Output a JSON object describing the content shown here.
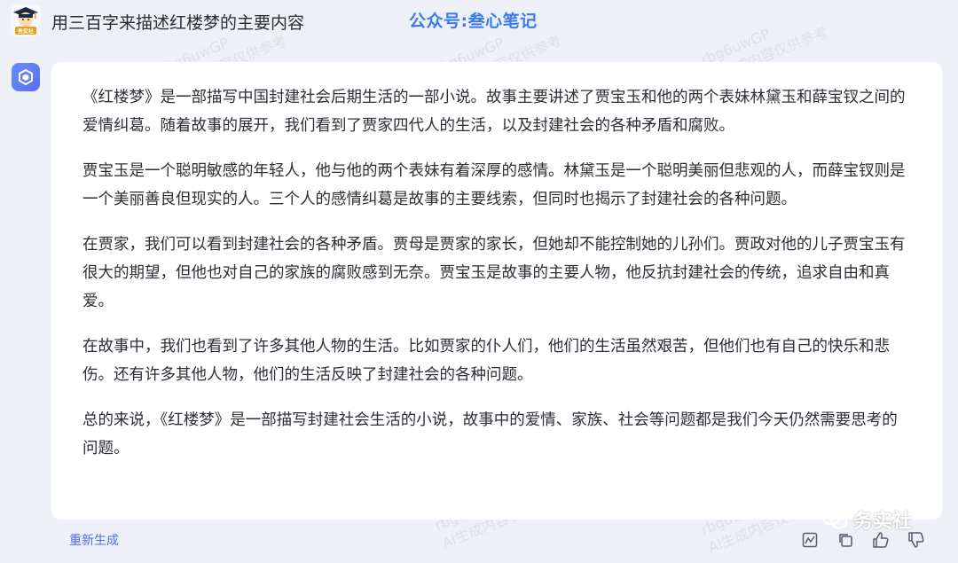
{
  "user": {
    "avatar_caption": "务实社",
    "question": "用三百字来描述红楼梦的主要内容"
  },
  "banner": "公众号:叁心笔记",
  "answer": {
    "paragraphs": [
      "《红楼梦》是一部描写中国封建社会后期生活的一部小说。故事主要讲述了贾宝玉和他的两个表妹林黛玉和薛宝钗之间的爱情纠葛。随着故事的展开，我们看到了贾家四代人的生活，以及封建社会的各种矛盾和腐败。",
      "贾宝玉是一个聪明敏感的年轻人，他与他的两个表妹有着深厚的感情。林黛玉是一个聪明美丽但悲观的人，而薛宝钗则是一个美丽善良但现实的人。三个人的感情纠葛是故事的主要线索，但同时也揭示了封建社会的各种问题。",
      "在贾家，我们可以看到封建社会的各种矛盾。贾母是贾家的家长，但她却不能控制她的儿孙们。贾政对他的儿子贾宝玉有很大的期望，但他也对自己的家族的腐败感到无奈。贾宝玉是故事的主要人物，他反抗封建社会的传统，追求自由和真爱。",
      "在故事中，我们也看到了许多其他人物的生活。比如贾家的仆人们，他们的生活虽然艰苦，但他们也有自己的快乐和悲伤。还有许多其他人物，他们的生活反映了封建社会的各种问题。",
      "总的来说，《红楼梦》是一部描写封建社会生活的小说，故事中的爱情、家族、社会等问题都是我们今天仍然需要思考的问题。"
    ]
  },
  "actions": {
    "regenerate": "重新生成"
  },
  "watermark": {
    "code": "rbg6uwGP",
    "notice": "AI生成内容仅供参考"
  },
  "brand": "务实社",
  "colors": {
    "background": "#eef0f8",
    "card": "#ffffff",
    "banner": "#3d7bea",
    "link": "#4f6fe0",
    "bot_icon": "#5a6df0"
  },
  "icons": [
    "avatar",
    "bot-logo-icon",
    "chart-icon",
    "copy-icon",
    "thumbs-up-icon",
    "thumbs-down-icon",
    "wechat-icon"
  ]
}
